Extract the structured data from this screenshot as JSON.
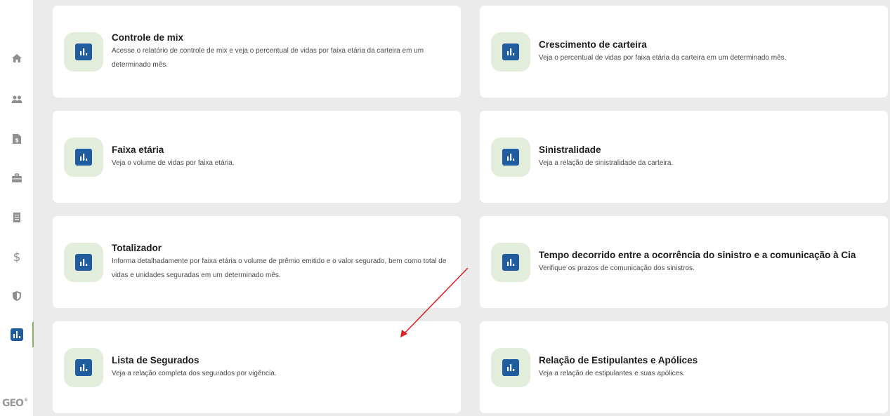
{
  "sidebar": {
    "items": [
      {
        "name": "home-icon"
      },
      {
        "name": "users-icon"
      },
      {
        "name": "document-icon"
      },
      {
        "name": "briefcase-icon"
      },
      {
        "name": "receipt-icon"
      },
      {
        "name": "dollar-icon"
      },
      {
        "name": "shield-icon"
      },
      {
        "name": "chart-icon",
        "active": true
      }
    ],
    "logo_text": "GEO",
    "logo_mark": "®",
    "active_color": "#8bb06a"
  },
  "cards": [
    {
      "title": "Controle de mix",
      "description": "Acesse o relatório de controle de mix e veja o percentual de vidas por faixa etária da carteira em um determinado mês."
    },
    {
      "title": "Crescimento de carteira",
      "description": "Veja o percentual de vidas por faixa etária da carteira em um determinado mês."
    },
    {
      "title": "Faixa etária",
      "description": "Veja o volume de vidas por faixa etária."
    },
    {
      "title": "Sinistralidade",
      "description": "Veja a relação de sinistralidade da carteira."
    },
    {
      "title": "Totalizador",
      "description": "Informa detalhadamente por faixa etária o volume de prêmio emitido e o valor segurado, bem como total de vidas e unidades seguradas em um determinado mês."
    },
    {
      "title": "Tempo decorrido entre a ocorrência do sinistro e a comunicação à Cia",
      "description": "Verifique os prazos de comunicação dos sinistros."
    },
    {
      "title": "Lista de Segurados",
      "description": "Veja a relação completa dos segurados por vigência."
    },
    {
      "title": "Relação de Estipulantes e Apólices",
      "description": "Veja a relação de estipulantes e suas apólices."
    }
  ],
  "colors": {
    "icon_bg": "#e3eddc",
    "icon_fg": "#1f5d9f",
    "annotation_arrow": "#e02020"
  }
}
